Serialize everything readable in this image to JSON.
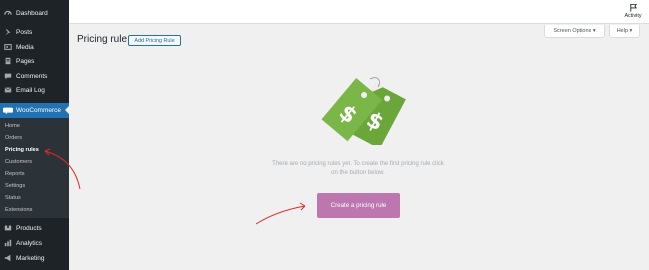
{
  "sidebar": {
    "items": [
      {
        "label": "Dashboard",
        "icon": "dashboard-icon"
      },
      {
        "label": "Posts",
        "icon": "pin-icon"
      },
      {
        "label": "Media",
        "icon": "media-icon"
      },
      {
        "label": "Pages",
        "icon": "pages-icon"
      },
      {
        "label": "Comments",
        "icon": "comment-icon"
      },
      {
        "label": "Email Log",
        "icon": "email-icon"
      }
    ],
    "woocommerce": {
      "label": "WooCommerce",
      "icon": "woo-icon"
    },
    "submenu": [
      "Home",
      "Orders",
      "Pricing rules",
      "Customers",
      "Reports",
      "Settings",
      "Status",
      "Extensions"
    ],
    "submenu_current": "Pricing rules",
    "bottom_items": [
      {
        "label": "Products",
        "icon": "products-icon"
      },
      {
        "label": "Analytics",
        "icon": "analytics-icon"
      },
      {
        "label": "Marketing",
        "icon": "megaphone-icon"
      }
    ]
  },
  "topbar": {
    "activity_label": "Activity",
    "screen_options_label": "Screen Options ▾",
    "help_label": "Help ▾"
  },
  "main": {
    "title": "Pricing rule",
    "add_button_label": "Add Pricing Rule",
    "empty_line1": "There are no pricing rules yet. To create the first pricing rule click",
    "empty_line2": "on the button below.",
    "cta_label": "Create a pricing rule",
    "tag_symbol": "$"
  },
  "colors": {
    "sidebar_bg": "#1d2327",
    "submenu_bg": "#2c3338",
    "accent_blue": "#2271b1",
    "cta_purple": "#bb77ae",
    "tag_green": "#7ab648",
    "annotation_red": "#e02b27"
  }
}
